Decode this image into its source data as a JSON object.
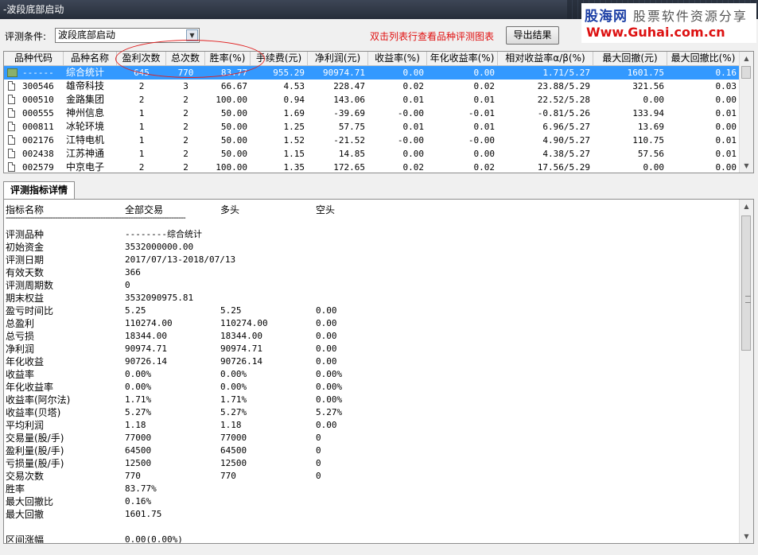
{
  "window": {
    "title": "-波段底部启动"
  },
  "watermark": {
    "line1_brand": "股海网",
    "line1_slogan": "股票软件资源分享",
    "line2": "Www.Guhai.com.cn"
  },
  "toolbar": {
    "criteria_label": "评测条件:",
    "criteria_value": "波段底部启动",
    "hint": "双击列表行查看品种评测图表",
    "export_label": "导出结果"
  },
  "table": {
    "columns": [
      "品种代码",
      "品种名称",
      "盈利次数",
      "总次数",
      "胜率(%)",
      "手续费(元)",
      "净利润(元)",
      "收益率(%)",
      "年化收益率(%)",
      "相对收益率α/β(%)",
      "最大回撤(元)",
      "最大回撤比(%)"
    ],
    "rows": [
      [
        "------",
        "综合统计",
        "645",
        "770",
        "83.77",
        "955.29",
        "90974.71",
        "0.00",
        "0.00",
        "1.71/5.27",
        "1601.75",
        "0.16"
      ],
      [
        "300546",
        "雄帝科技",
        "2",
        "3",
        "66.67",
        "4.53",
        "228.47",
        "0.02",
        "0.02",
        "23.88/5.29",
        "321.56",
        "0.03"
      ],
      [
        "000510",
        "金路集团",
        "2",
        "2",
        "100.00",
        "0.94",
        "143.06",
        "0.01",
        "0.01",
        "22.52/5.28",
        "0.00",
        "0.00"
      ],
      [
        "000555",
        "神州信息",
        "1",
        "2",
        "50.00",
        "1.69",
        "-39.69",
        "-0.00",
        "-0.01",
        "-0.81/5.26",
        "133.94",
        "0.01"
      ],
      [
        "000811",
        "冰轮环境",
        "1",
        "2",
        "50.00",
        "1.25",
        "57.75",
        "0.01",
        "0.01",
        "6.96/5.27",
        "13.69",
        "0.00"
      ],
      [
        "002176",
        "江特电机",
        "1",
        "2",
        "50.00",
        "1.52",
        "-21.52",
        "-0.00",
        "-0.00",
        "4.90/5.27",
        "110.75",
        "0.01"
      ],
      [
        "002438",
        "江苏神通",
        "1",
        "2",
        "50.00",
        "1.15",
        "14.85",
        "0.00",
        "0.00",
        "4.38/5.27",
        "57.56",
        "0.01"
      ],
      [
        "002579",
        "中京电子",
        "2",
        "2",
        "100.00",
        "1.35",
        "172.65",
        "0.02",
        "0.02",
        "17.56/5.29",
        "0.00",
        "0.00"
      ]
    ]
  },
  "tab": {
    "label": "评测指标详情"
  },
  "details": {
    "headers": [
      "指标名称",
      "全部交易",
      "多头",
      "空头"
    ],
    "separator": "----------------------------------------------------------------------------",
    "rows": [
      [
        "评测品种",
        "--------综合统计",
        "",
        ""
      ],
      [
        "初始资金",
        "3532000000.00",
        "",
        ""
      ],
      [
        "评测日期",
        "2017/07/13-2018/07/13",
        "",
        ""
      ],
      [
        "有效天数",
        "366",
        "",
        ""
      ],
      [
        "评测周期数",
        "0",
        "",
        ""
      ],
      [
        "期末权益",
        "3532090975.81",
        "",
        ""
      ],
      [
        "盈亏时间比",
        "5.25",
        "5.25",
        "0.00"
      ],
      [
        "总盈利",
        "110274.00",
        "110274.00",
        "0.00"
      ],
      [
        "总亏损",
        "18344.00",
        "18344.00",
        "0.00"
      ],
      [
        "净利润",
        "90974.71",
        "90974.71",
        "0.00"
      ],
      [
        "年化收益",
        "90726.14",
        "90726.14",
        "0.00"
      ],
      [
        "收益率",
        "0.00%",
        "0.00%",
        "0.00%"
      ],
      [
        "年化收益率",
        "0.00%",
        "0.00%",
        "0.00%"
      ],
      [
        "收益率(阿尔法)",
        "1.71%",
        "1.71%",
        "0.00%"
      ],
      [
        "收益率(贝塔)",
        "5.27%",
        "5.27%",
        "5.27%"
      ],
      [
        "平均利润",
        "1.18",
        "1.18",
        "0.00"
      ],
      [
        "交易量(股/手)",
        "77000",
        "77000",
        "0"
      ],
      [
        "盈利量(股/手)",
        "64500",
        "64500",
        "0"
      ],
      [
        "亏损量(股/手)",
        "12500",
        "12500",
        "0"
      ],
      [
        "交易次数",
        "770",
        "770",
        "0"
      ],
      [
        "胜率",
        "83.77%",
        "",
        ""
      ],
      [
        "最大回撤比",
        "0.16%",
        "",
        ""
      ],
      [
        "最大回撤",
        "1601.75",
        "",
        ""
      ],
      [
        "",
        "",
        " ",
        ""
      ],
      [
        "区间涨幅",
        "0.00(0.00%)",
        "",
        ""
      ]
    ]
  },
  "colors": {
    "selection": "#3399ff",
    "hint": "#e01010",
    "annotation": "#e02020",
    "watermark_brand": "#1c3fa5",
    "watermark_url": "#dd1111"
  },
  "icons": [
    "document-icon",
    "summary-icon",
    "chevron-down-icon",
    "scroll-up-icon",
    "scroll-down-icon"
  ]
}
